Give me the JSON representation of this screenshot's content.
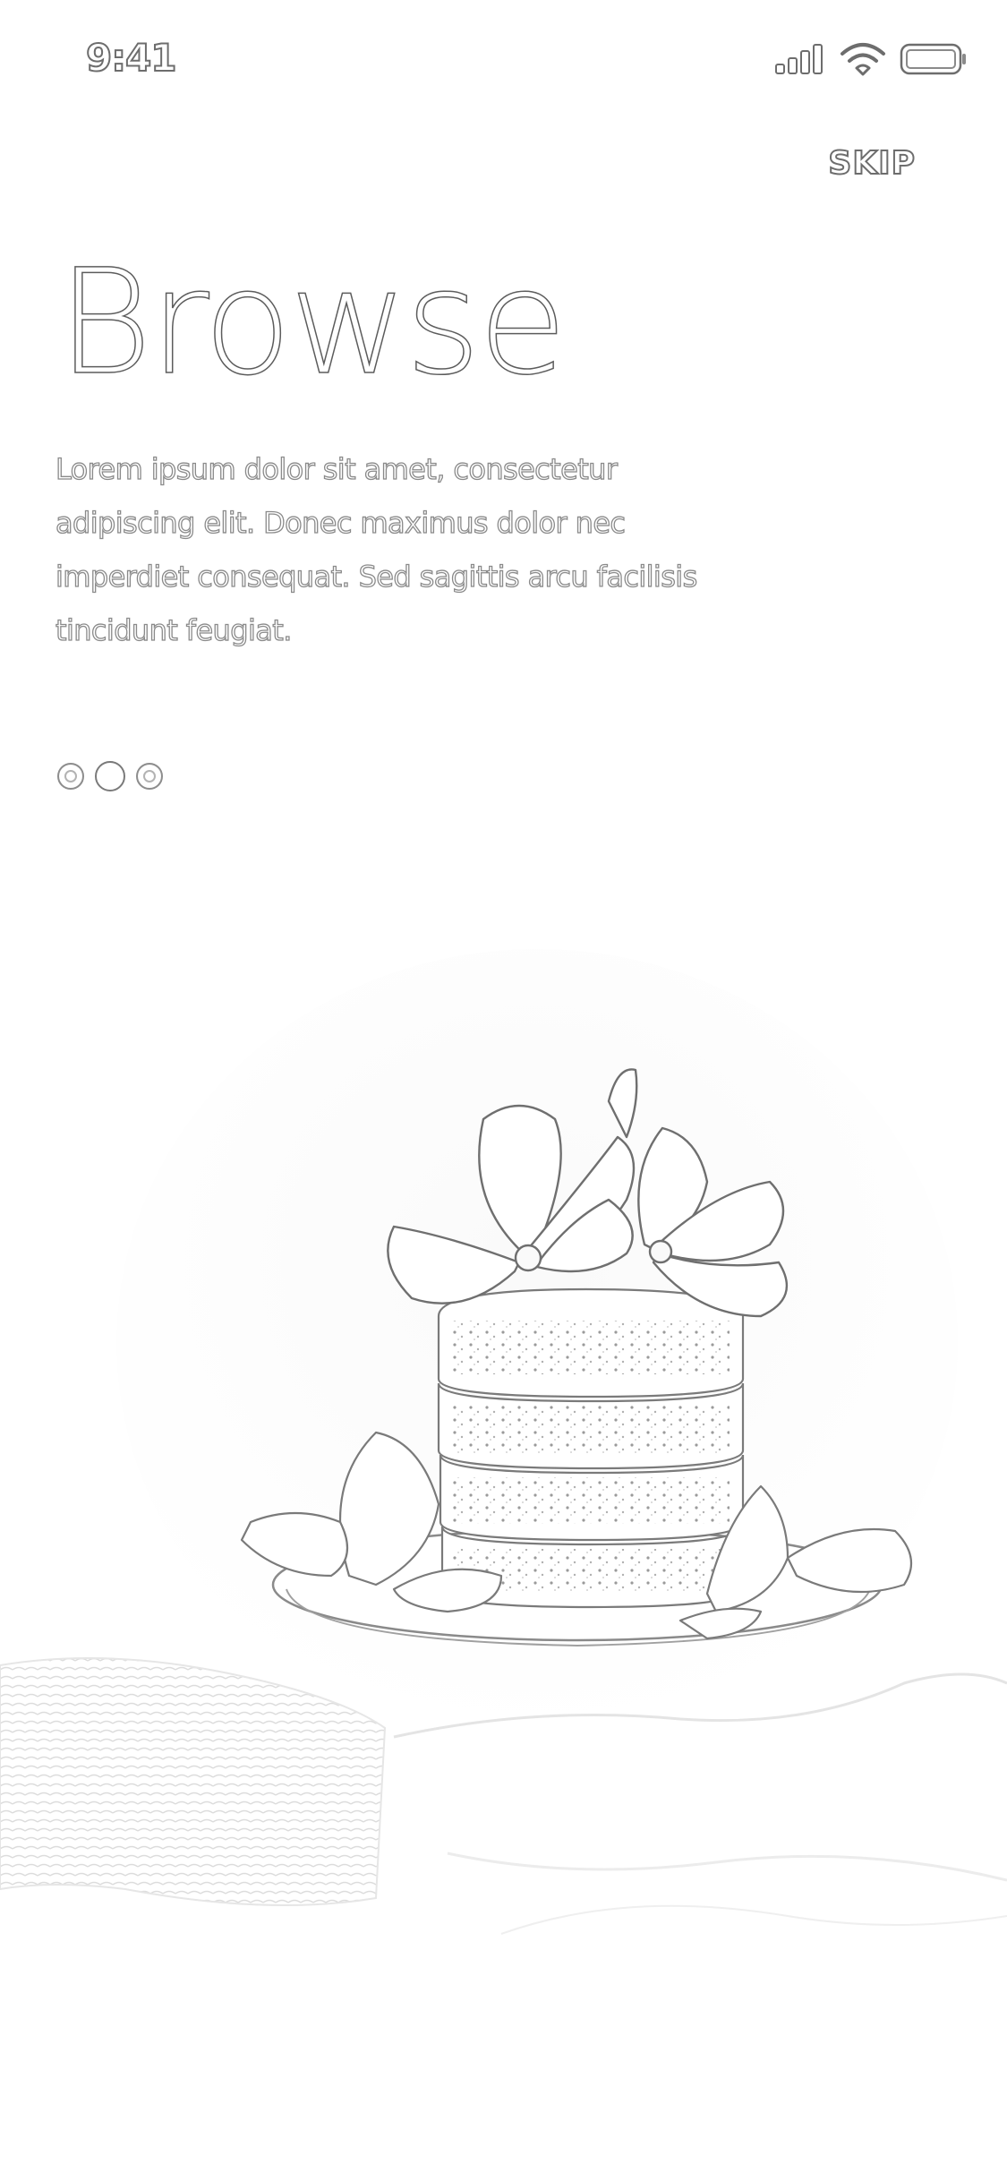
{
  "status_bar": {
    "time": "9:41",
    "icons": [
      "signal-icon",
      "wifi-icon",
      "battery-icon"
    ]
  },
  "header": {
    "skip_label": "SKIP"
  },
  "onboarding": {
    "title": "Browse",
    "description": "Lorem ipsum dolor sit amet, consectetur adipiscing elit. Donec maximus dolor nec imperdiet consequat. Sed sagittis arcu facilisis tincidunt feugiat.",
    "pages_total": 3,
    "current_page": 2
  },
  "hero_image": {
    "subject": "layered-cake-with-flowers-illustration"
  },
  "colors": {
    "background": "#ffffff",
    "outline": "#6d6d6d"
  }
}
